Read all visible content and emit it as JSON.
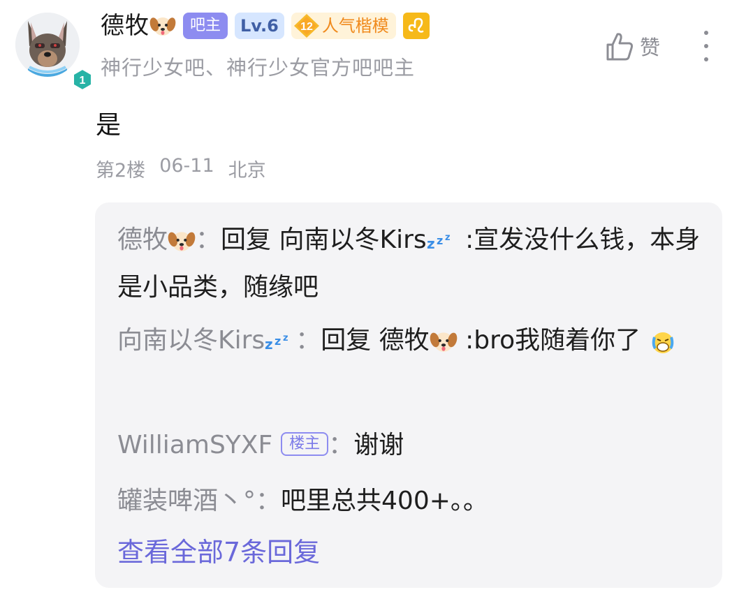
{
  "header": {
    "username": "德牧",
    "badge_owner": "吧主",
    "badge_level": "Lv.6",
    "popularity_level": "12",
    "popularity_label": "人气楷模",
    "subtitle": "神行少女吧、神行少女官方吧吧主",
    "avatar_level": "1"
  },
  "actions": {
    "like_label": "赞"
  },
  "post": {
    "body": "是",
    "floor": "第2楼",
    "date": "06-11",
    "location": "北京"
  },
  "replies": [
    {
      "name": "德牧",
      "sep": "：",
      "text_pre": "回复 向南以冬Kirs",
      "text_post": " :宣发没什么钱，本身是小品类，随缘吧"
    },
    {
      "name": "向南以冬Kirs",
      "sep": "：",
      "text_pre": "回复 德牧",
      "text_post": " :bro我随着你了"
    },
    {
      "name": "WilliamSYXF",
      "tag": "楼主",
      "sep": "：",
      "text": "谢谢"
    },
    {
      "name": "罐装啤酒丶°",
      "sep": "：",
      "text": "吧里总共400+。。"
    }
  ],
  "view_all": "查看全部7条回复",
  "colors": {
    "accent": "#6a68da",
    "badge_owner": "#8d8cf0",
    "muted_text": "#9b9ca3",
    "reply_bg": "#f4f4f6"
  },
  "icons": [
    "dog-emoji-icon",
    "zzz-emoji-icon",
    "crying-emoji-icon",
    "thumbs-up-icon",
    "more-vertical-icon",
    "diamond-icon",
    "leo-zodiac-icon"
  ]
}
